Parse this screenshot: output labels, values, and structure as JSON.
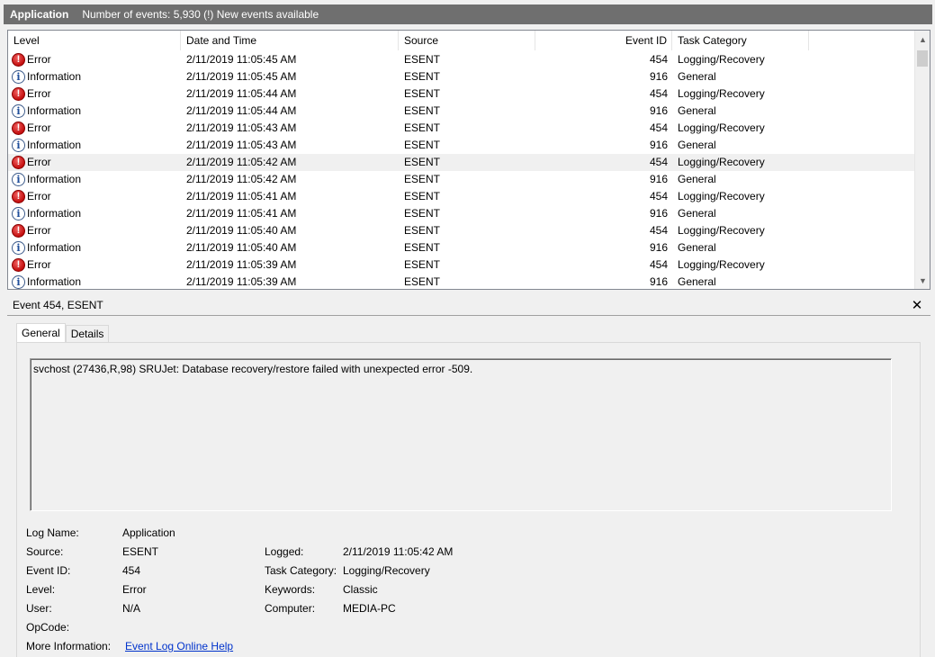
{
  "titlebar": {
    "title": "Application",
    "info": "Number of events: 5,930 (!) New events available"
  },
  "columns": {
    "level": "Level",
    "date": "Date and Time",
    "source": "Source",
    "event_id": "Event ID",
    "category": "Task Category"
  },
  "icons": {
    "error": "error-icon",
    "information": "information-icon"
  },
  "colors": {
    "error": "#c40e0e",
    "information": "#1f4e9b",
    "link": "#0033cc"
  },
  "events": [
    {
      "level": "Error",
      "date": "2/11/2019 11:05:45 AM",
      "source": "ESENT",
      "event_id": "454",
      "category": "Logging/Recovery"
    },
    {
      "level": "Information",
      "date": "2/11/2019 11:05:45 AM",
      "source": "ESENT",
      "event_id": "916",
      "category": "General"
    },
    {
      "level": "Error",
      "date": "2/11/2019 11:05:44 AM",
      "source": "ESENT",
      "event_id": "454",
      "category": "Logging/Recovery"
    },
    {
      "level": "Information",
      "date": "2/11/2019 11:05:44 AM",
      "source": "ESENT",
      "event_id": "916",
      "category": "General"
    },
    {
      "level": "Error",
      "date": "2/11/2019 11:05:43 AM",
      "source": "ESENT",
      "event_id": "454",
      "category": "Logging/Recovery"
    },
    {
      "level": "Information",
      "date": "2/11/2019 11:05:43 AM",
      "source": "ESENT",
      "event_id": "916",
      "category": "General"
    },
    {
      "level": "Error",
      "date": "2/11/2019 11:05:42 AM",
      "source": "ESENT",
      "event_id": "454",
      "category": "Logging/Recovery"
    },
    {
      "level": "Information",
      "date": "2/11/2019 11:05:42 AM",
      "source": "ESENT",
      "event_id": "916",
      "category": "General"
    },
    {
      "level": "Error",
      "date": "2/11/2019 11:05:41 AM",
      "source": "ESENT",
      "event_id": "454",
      "category": "Logging/Recovery"
    },
    {
      "level": "Information",
      "date": "2/11/2019 11:05:41 AM",
      "source": "ESENT",
      "event_id": "916",
      "category": "General"
    },
    {
      "level": "Error",
      "date": "2/11/2019 11:05:40 AM",
      "source": "ESENT",
      "event_id": "454",
      "category": "Logging/Recovery"
    },
    {
      "level": "Information",
      "date": "2/11/2019 11:05:40 AM",
      "source": "ESENT",
      "event_id": "916",
      "category": "General"
    },
    {
      "level": "Error",
      "date": "2/11/2019 11:05:39 AM",
      "source": "ESENT",
      "event_id": "454",
      "category": "Logging/Recovery"
    },
    {
      "level": "Information",
      "date": "2/11/2019 11:05:39 AM",
      "source": "ESENT",
      "event_id": "916",
      "category": "General"
    }
  ],
  "selected_row": 6,
  "detail": {
    "title": "Event 454, ESENT",
    "close_label": "✕",
    "tabs": [
      "General",
      "Details"
    ],
    "active_tab": "General",
    "description": "svchost (27436,R,98) SRUJet: Database recovery/restore failed with unexpected error -509.",
    "labels": {
      "log_name": "Log Name:",
      "source": "Source:",
      "event_id": "Event ID:",
      "level": "Level:",
      "user": "User:",
      "opcode": "OpCode:",
      "more_info": "More Information:",
      "logged": "Logged:",
      "task_category": "Task Category:",
      "keywords": "Keywords:",
      "computer": "Computer:"
    },
    "values": {
      "log_name": "Application",
      "source": "ESENT",
      "event_id": "454",
      "level": "Error",
      "user": "N/A",
      "opcode": "",
      "more_info_link": "Event Log Online Help",
      "logged": "2/11/2019 11:05:42 AM",
      "task_category": "Logging/Recovery",
      "keywords": "Classic",
      "computer": "MEDIA-PC"
    }
  }
}
